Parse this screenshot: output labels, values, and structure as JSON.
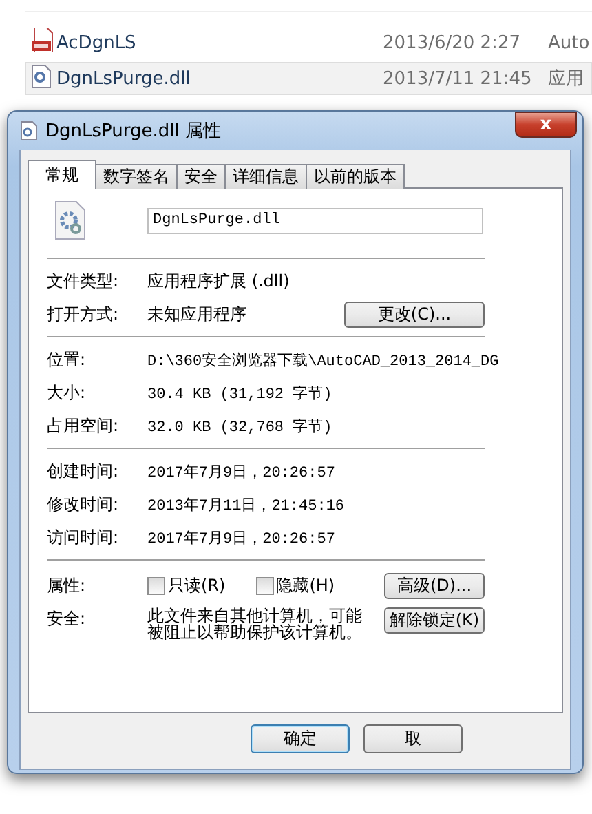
{
  "explorer": {
    "rows": [
      {
        "kind": "dbx",
        "name": "AcDgnLS",
        "modified": "2013/6/20 2:27",
        "type": "Auto",
        "selected": false
      },
      {
        "kind": "dll",
        "name": "DgnLsPurge.dll",
        "modified": "2013/7/11 21:45",
        "type": "应用",
        "selected": true
      }
    ]
  },
  "window": {
    "title": "DgnLsPurge.dll 属性",
    "close": "x"
  },
  "tabs": [
    {
      "label": "常规",
      "selected": true
    },
    {
      "label": "数字签名",
      "selected": false
    },
    {
      "label": "安全",
      "selected": false
    },
    {
      "label": "详细信息",
      "selected": false
    },
    {
      "label": "以前的版本",
      "selected": false
    }
  ],
  "file_name": "DgnLsPurge.dll",
  "groups": [
    [
      {
        "label": "文件类型:",
        "value": "应用程序扩展 (.dll)"
      },
      {
        "label": "打开方式:",
        "value": "未知应用程序",
        "button": "更改(C)..."
      }
    ],
    [
      {
        "label": "位置:",
        "value": "D:\\360安全浏览器下载\\AutoCAD_2013_2014_DG"
      },
      {
        "label": "大小:",
        "value": "30.4 KB (31,192 字节)"
      },
      {
        "label": "占用空间:",
        "value": "32.0 KB (32,768 字节)"
      }
    ],
    [
      {
        "label": "创建时间:",
        "value": "2017年7月9日，20:26:57"
      },
      {
        "label": "修改时间:",
        "value": "2013年7月11日，21:45:16"
      },
      {
        "label": "访问时间:",
        "value": "2017年7月9日，20:26:57"
      }
    ]
  ],
  "attributes": {
    "label": "属性:",
    "checkboxes": [
      {
        "label": "只读(R)",
        "checked": false
      },
      {
        "label": "隐藏(H)",
        "checked": false
      }
    ],
    "button": "高级(D)..."
  },
  "security": {
    "label": "安全:",
    "text": "此文件来自其他计算机，可能被阻止以帮助保护该计算机。",
    "button": "解除锁定(K)"
  },
  "buttons": [
    {
      "label": "确定",
      "selected": true
    },
    {
      "label": "取",
      "selected": false
    }
  ]
}
